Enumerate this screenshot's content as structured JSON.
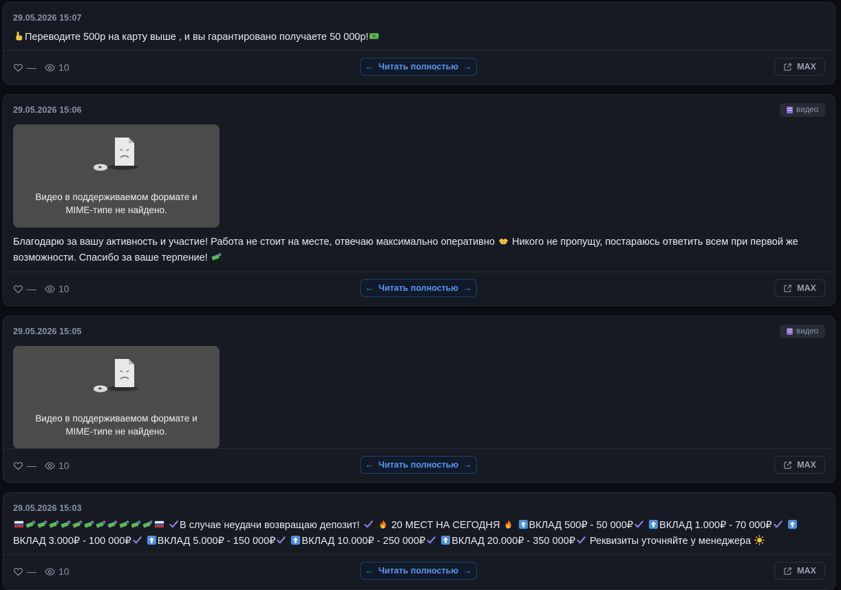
{
  "colors": {
    "background": "#0b0d12",
    "card": "#161a22",
    "accent": "#5c95f0",
    "muted": "#8a93a6",
    "video_badge_icon": "#8b6fd0"
  },
  "footer_labels": {
    "likes": "—",
    "read_full": "Читать полностью",
    "max": "MAX"
  },
  "posts": [
    {
      "date": "29.05.2026 15:07",
      "badge": "",
      "text_prefix_emoji": "point-up-emoji",
      "text": "Переводите 500р на карту выше , и вы гарантировано получаете 50 000р!",
      "text_suffix_emoji": "dollar-banknote-emoji",
      "views": "10"
    },
    {
      "date": "29.05.2026 15:06",
      "badge": "видео",
      "video_message_line1": "Видео в поддерживаемом формате и",
      "video_message_line2": "MIME-типе не найдено.",
      "text_part1": "Благодарю за вашу активность и участие! Работа не стоит на месте, отвечаю максимально оперативно",
      "text_part2": "Никого не пропущу, постараюсь ответить всем при первой же возможности. Спасибо за ваше терпение!",
      "views": "10"
    },
    {
      "date": "29.05.2026 15:05",
      "badge": "видео",
      "video_message_line1": "Видео в поддерживаемом формате и",
      "video_message_line2": "MIME-типе не найдено.",
      "views": "10"
    },
    {
      "date": "29.05.2026 15:03",
      "badge": "",
      "text_segments": [
        "В случае неудачи возвращаю депозит!",
        "20 МЕСТ НА СЕГОДНЯ",
        "ВКЛАД 500₽ - 50 000₽",
        "ВКЛАД 1.000₽ - 70 000₽",
        "ВКЛАД 3.000₽ - 100 000₽",
        "ВКЛАД 5.000₽ - 150 000₽",
        "ВКЛАД 10.000₽ - 250 000₽",
        "ВКЛАД 20.000₽ - 350 000₽",
        "Реквизиты уточняйте у менеджера"
      ],
      "views": "10"
    }
  ]
}
